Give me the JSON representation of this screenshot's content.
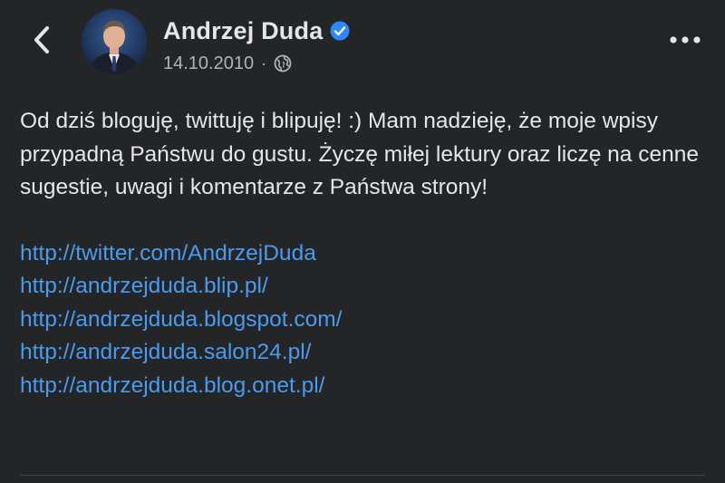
{
  "header": {
    "back_icon": "chevron-left-icon",
    "author_name": "Andrzej Duda",
    "verified_icon": "verified-badge-icon",
    "date": "14.10.2010",
    "separator": "·",
    "audience_icon": "globe-icon",
    "more_icon": "more-horizontal-icon"
  },
  "post": {
    "text": "Od dziś bloguję, twittuję i blipuję! :) Mam nadzieję, że moje wpisy przypadną Państwu do gustu. Życzę miłej lektury oraz liczę na cenne sugestie, uwagi i komentarze z Państwa strony!",
    "links": [
      "http://twitter.com/AndrzejDuda",
      "http://andrzejduda.blip.pl/",
      "http://andrzejduda.blogspot.com/",
      "http://andrzejduda.salon24.pl/",
      "http://andrzejduda.blog.onet.pl/"
    ]
  },
  "colors": {
    "background": "#242526",
    "text": "#e4e6eb",
    "secondary_text": "#b0b3b8",
    "link": "#4a9bf0",
    "verified": "#2d88ff"
  }
}
